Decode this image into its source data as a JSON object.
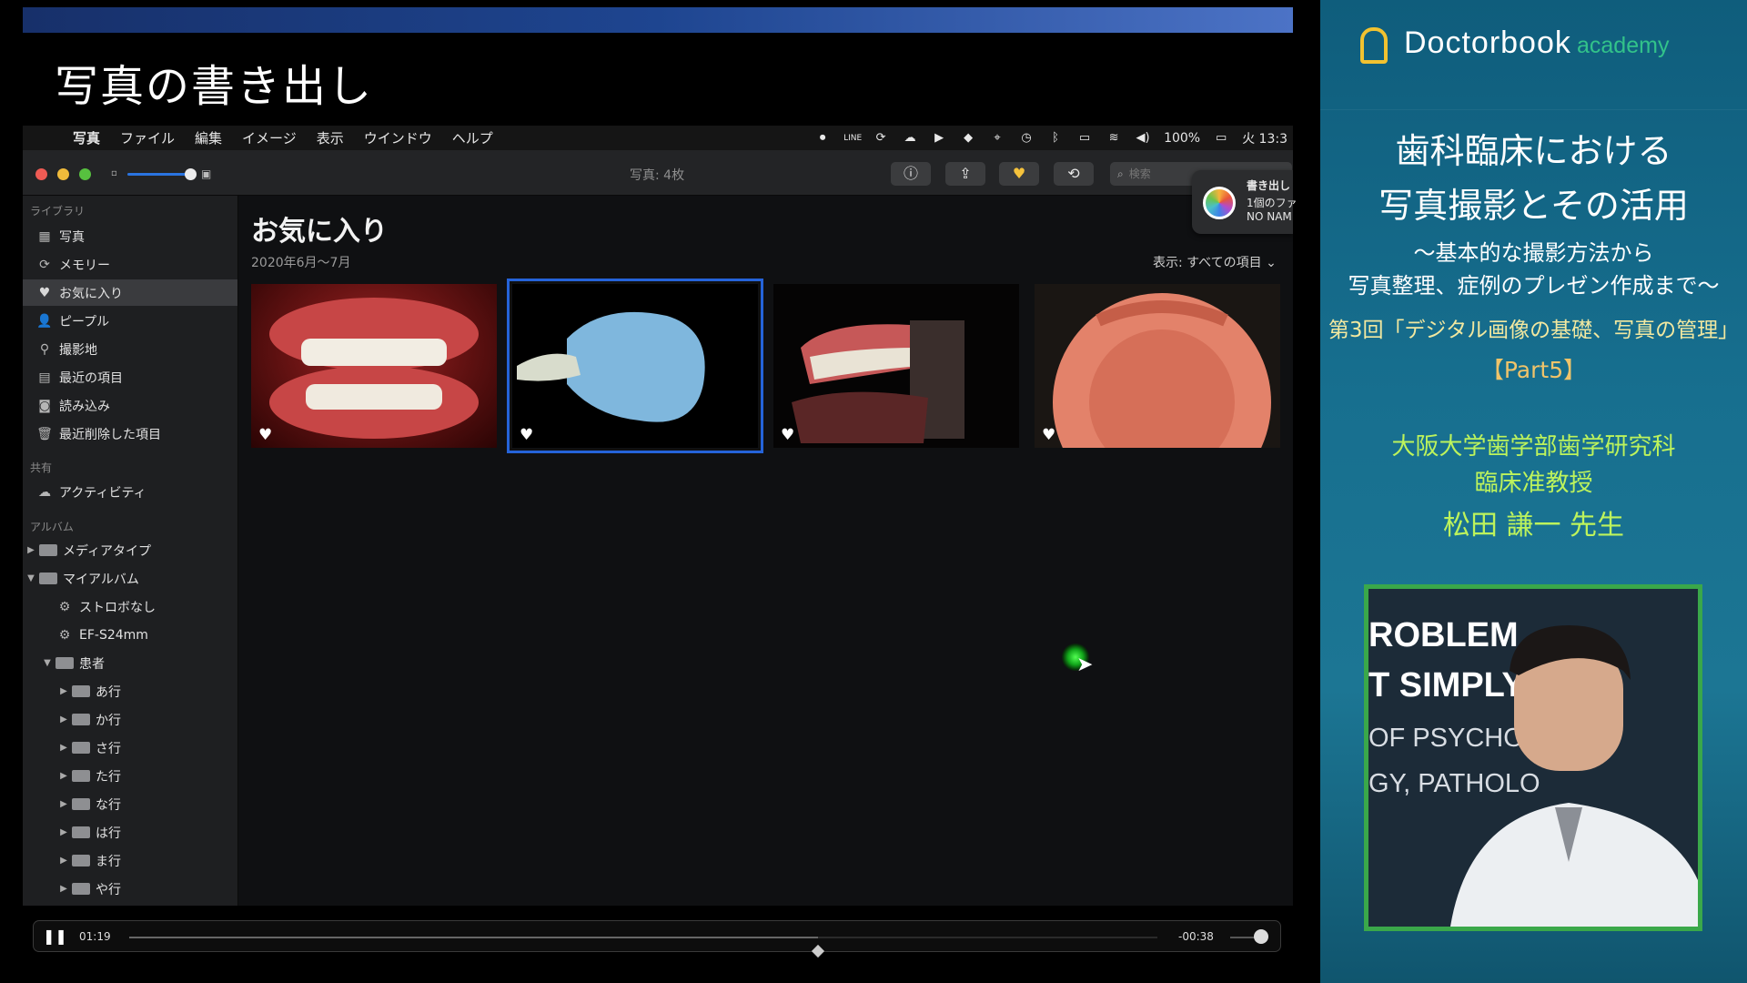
{
  "slide": {
    "title": "写真の書き出し"
  },
  "menubar": {
    "items": [
      "写真",
      "ファイル",
      "編集",
      "イメージ",
      "表示",
      "ウインドウ",
      "ヘルプ"
    ],
    "battery": "100%",
    "clock": "火 13:3",
    "icons": [
      "record-icon",
      "line-icon",
      "sync-icon",
      "cloud-icon",
      "play-icon",
      "dropbox-icon",
      "target-icon",
      "time-machine-icon",
      "bluetooth-icon",
      "airplay-icon",
      "wifi-icon",
      "volume-icon",
      "battery-icon"
    ]
  },
  "toolbar": {
    "photo_count": "写真: 4枚",
    "search_placeholder": "検索"
  },
  "notification": {
    "line1": "書き出し",
    "line2": "1個のファ",
    "line3": "NO NAM"
  },
  "sidebar": {
    "library_header": "ライブラリ",
    "library": [
      {
        "label": "写真",
        "icon": "photos-icon"
      },
      {
        "label": "メモリー",
        "icon": "memories-icon"
      },
      {
        "label": "お気に入り",
        "icon": "heart-icon"
      },
      {
        "label": "ピープル",
        "icon": "people-icon"
      },
      {
        "label": "撮影地",
        "icon": "places-icon"
      },
      {
        "label": "最近の項目",
        "icon": "recent-icon"
      },
      {
        "label": "読み込み",
        "icon": "import-icon"
      },
      {
        "label": "最近削除した項目",
        "icon": "trash-icon"
      }
    ],
    "shared_header": "共有",
    "shared": [
      {
        "label": "アクティビティ",
        "icon": "cloud-icon"
      }
    ],
    "albums_header": "アルバム",
    "albums": [
      {
        "label": "メディアタイプ",
        "icon": "folder-icon"
      },
      {
        "label": "マイアルバム",
        "icon": "folder-icon"
      },
      {
        "label": "ストロボなし",
        "icon": "gear-icon"
      },
      {
        "label": "EF-S24mm",
        "icon": "gear-icon"
      },
      {
        "label": "患者",
        "icon": "folder-icon"
      },
      {
        "label": "あ行",
        "icon": "folder-icon"
      },
      {
        "label": "か行",
        "icon": "folder-icon"
      },
      {
        "label": "さ行",
        "icon": "folder-icon"
      },
      {
        "label": "た行",
        "icon": "folder-icon"
      },
      {
        "label": "な行",
        "icon": "folder-icon"
      },
      {
        "label": "は行",
        "icon": "folder-icon"
      },
      {
        "label": "ま行",
        "icon": "folder-icon"
      },
      {
        "label": "や行",
        "icon": "folder-icon"
      }
    ]
  },
  "main": {
    "title": "お気に入り",
    "date_range": "2020年6月〜7月",
    "filter_label": "表示: すべての項目"
  },
  "player": {
    "current_time": "01:19",
    "remaining_time": "-00:38",
    "progress": 0.67
  },
  "panel": {
    "logo_main": "Doctorbook",
    "logo_sub": "academy",
    "title_line1": "歯科臨床における",
    "title_line2": "写真撮影とその活用",
    "subtitle_line1": "〜基本的な撮影方法から",
    "subtitle_line2": "写真整理、症例のプレゼン作成まで〜",
    "episode": "第3回「デジタル画像の基礎、写真の管理」",
    "part": "【Part5】",
    "affiliation_line1": "大阪大学歯学部歯学研究科",
    "affiliation_line2": "臨床准教授",
    "speaker": "松田 謙一 先生"
  },
  "video": {
    "line1": "ROBLEM",
    "line2": "T SIMPLY",
    "line3": "OF PSYCHOL",
    "line4": "GY, PATHOLO"
  }
}
